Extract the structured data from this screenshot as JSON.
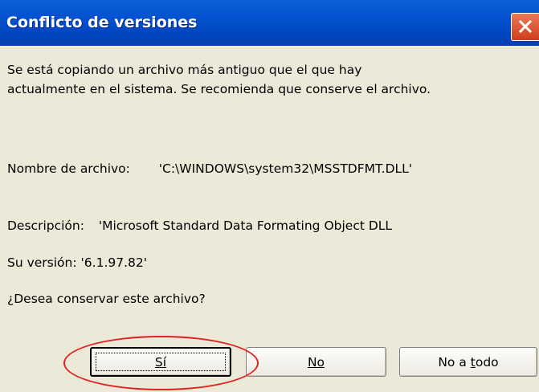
{
  "window": {
    "title": "Conflicto de versiones"
  },
  "message": {
    "line1": "Se está copiando un archivo más antiguo que el que hay",
    "line2": "actualmente en el sistema. Se recomienda que conserve el archivo."
  },
  "file": {
    "label": "Nombre de archivo:",
    "value": "'C:\\WINDOWS\\system32\\MSSTDFMT.DLL'"
  },
  "description": {
    "label": "Descripción:",
    "value": "'Microsoft Standard Data Formating Object DLL"
  },
  "version": {
    "label": "Su versión:",
    "value": "'6.1.97.82'"
  },
  "question": "¿Desea conservar este archivo?",
  "buttons": {
    "yes": "Sí",
    "no": "No",
    "no_to_all_prefix": "No a ",
    "no_to_all_accel": "t",
    "no_to_all_suffix": "odo"
  },
  "annotation": {
    "highlight_color": "#e0201f"
  },
  "icons": {
    "close": "close-icon"
  }
}
